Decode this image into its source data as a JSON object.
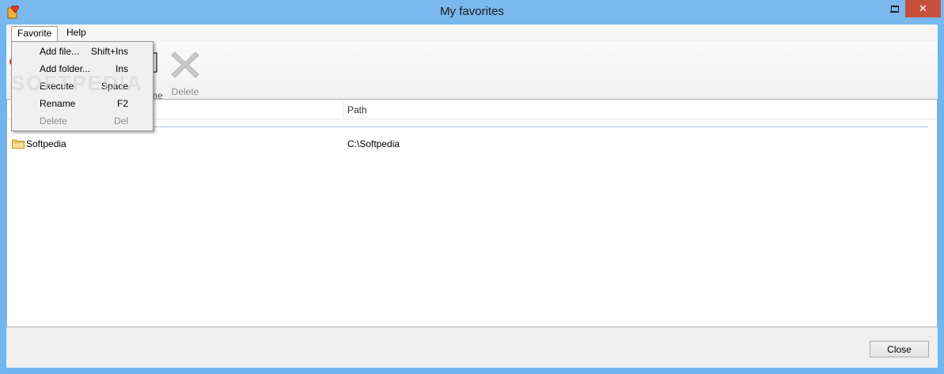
{
  "window": {
    "title": "My favorites",
    "app_icon": "favorites-heart-icon",
    "title_bar_color": "#7ab8ee",
    "close_color": "#c74f3e"
  },
  "menubar": {
    "items": [
      {
        "label": "Favorite",
        "open": true
      },
      {
        "label": "Help",
        "open": false
      }
    ]
  },
  "dropdown": {
    "items": [
      {
        "label": "Add file...",
        "shortcut": "Shift+Ins",
        "enabled": true
      },
      {
        "label": "Add folder...",
        "shortcut": "Ins",
        "enabled": true
      },
      {
        "label": "Execute",
        "shortcut": "Space",
        "enabled": true
      },
      {
        "label": "Rename",
        "shortcut": "F2",
        "enabled": true
      },
      {
        "label": "Delete",
        "shortcut": "Del",
        "enabled": false
      }
    ]
  },
  "toolbar": {
    "partial_label": "me",
    "delete_label": "Delete",
    "delete_icon": "delete-x-icon"
  },
  "listview": {
    "columns": [
      "",
      "Path"
    ],
    "rows": [
      {
        "name": "Softpedia",
        "path": "C:\\Softpedia",
        "icon": "folder-icon"
      }
    ]
  },
  "footer": {
    "close_label": "Close"
  },
  "watermark": "SOFTPEDIA"
}
